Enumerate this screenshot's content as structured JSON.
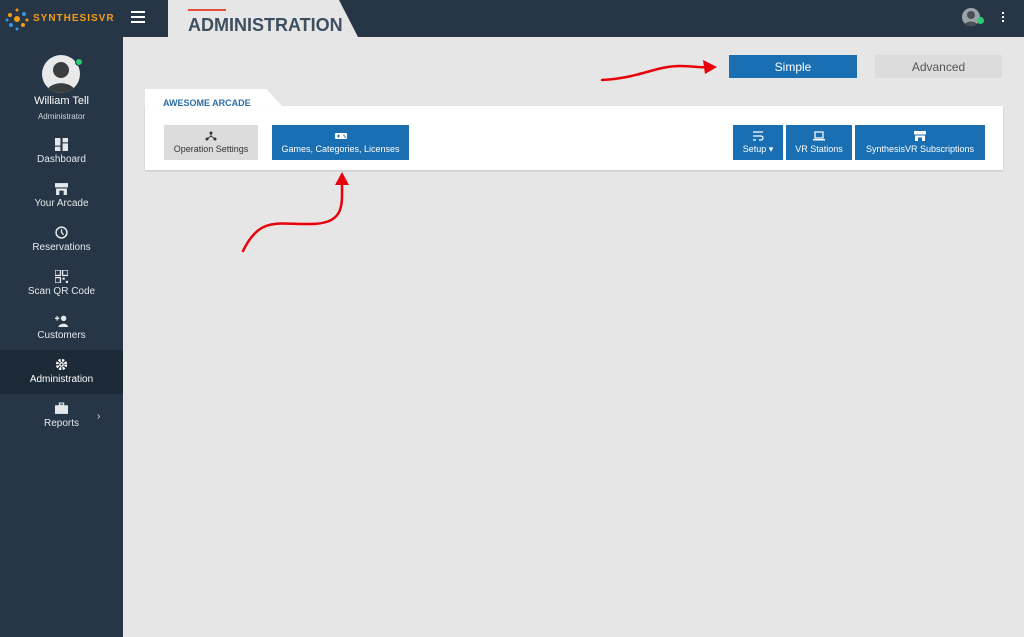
{
  "brand": {
    "name": "SYNTHESISVR"
  },
  "header": {
    "title": "ADMINISTRATION"
  },
  "user": {
    "name": "William Tell",
    "role": "Administrator"
  },
  "sidebar": {
    "items": [
      {
        "label": "Dashboard",
        "icon": "dashboard-icon"
      },
      {
        "label": "Your Arcade",
        "icon": "store-icon"
      },
      {
        "label": "Reservations",
        "icon": "clock-icon"
      },
      {
        "label": "Scan QR Code",
        "icon": "qr-code-icon"
      },
      {
        "label": "Customers",
        "icon": "person-add-icon"
      },
      {
        "label": "Administration",
        "icon": "gear-icon",
        "active": true
      },
      {
        "label": "Reports",
        "icon": "briefcase-icon"
      }
    ]
  },
  "mode": {
    "simple": "Simple",
    "advanced": "Advanced",
    "selected": "Simple"
  },
  "panel": {
    "tab": "AWESOME ARCADE",
    "buttons": {
      "operation_settings": "Operation Settings",
      "games": "Games, Categories, Licenses",
      "setup": "Setup",
      "vr_stations": "VR Stations",
      "subscriptions": "SynthesisVR Subscriptions"
    }
  },
  "colors": {
    "sidebar": "#263646",
    "accent": "#1a6fb3",
    "content_bg": "#e6e6e6",
    "annotation": "#e8000b"
  }
}
